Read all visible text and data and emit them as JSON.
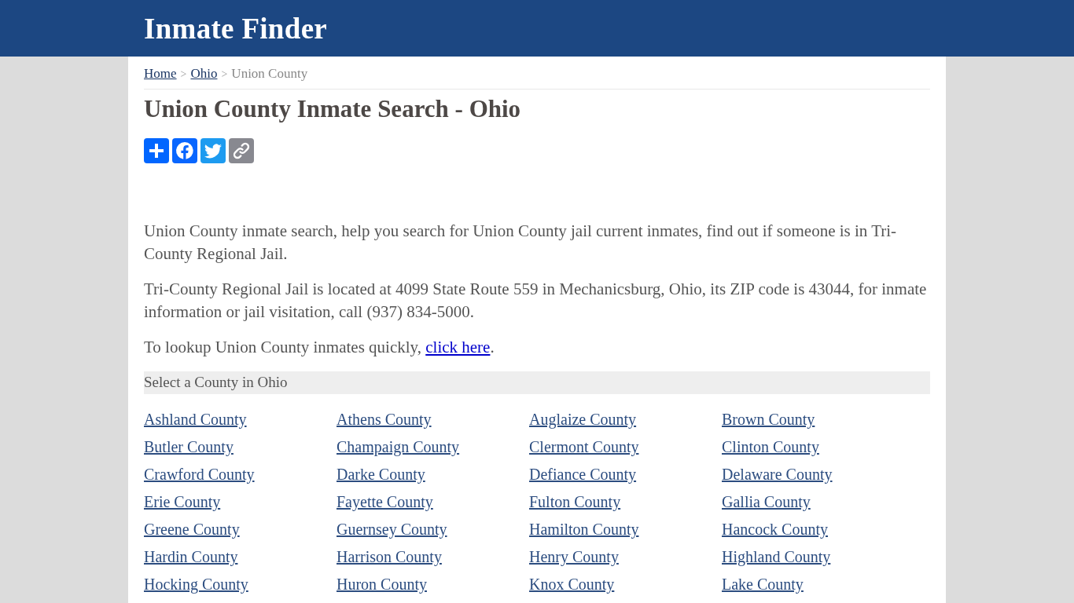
{
  "header": {
    "title": "Inmate Finder"
  },
  "breadcrumb": [
    {
      "kind": "link",
      "text": "Home"
    },
    {
      "kind": "separator",
      "text": ">"
    },
    {
      "kind": "link",
      "text": "Ohio"
    },
    {
      "kind": "separator",
      "text": ">"
    },
    {
      "kind": "current",
      "text": "Union County"
    }
  ],
  "heading": "Union County Inmate Search - Ohio",
  "paragraphs": [
    {
      "text": "Union County inmate search, help you search for Union County jail current inmates, find out if someone is in Tri-County Regional Jail."
    },
    {
      "text": "Tri-County Regional Jail is located at 4099 State Route 559 in Mechanicsburg, Ohio, its ZIP code is 43044, for inmate information or jail visitation, call (937) 834-5000."
    },
    {
      "text": "To lookup Union County inmates quickly, ",
      "link": "click here",
      "after": "."
    }
  ],
  "county_section": {
    "title": "Select a County in Ohio",
    "counties": [
      "Ashland County",
      "Athens County",
      "Auglaize County",
      "Brown County",
      "Butler County",
      "Champaign County",
      "Clermont County",
      "Clinton County",
      "Crawford County",
      "Darke County",
      "Defiance County",
      "Delaware County",
      "Erie County",
      "Fayette County",
      "Fulton County",
      "Gallia County",
      "Greene County",
      "Guernsey County",
      "Hamilton County",
      "Hancock County",
      "Hardin County",
      "Harrison County",
      "Henry County",
      "Highland County",
      "Hocking County",
      "Huron County",
      "Knox County",
      "Lake County"
    ]
  }
}
